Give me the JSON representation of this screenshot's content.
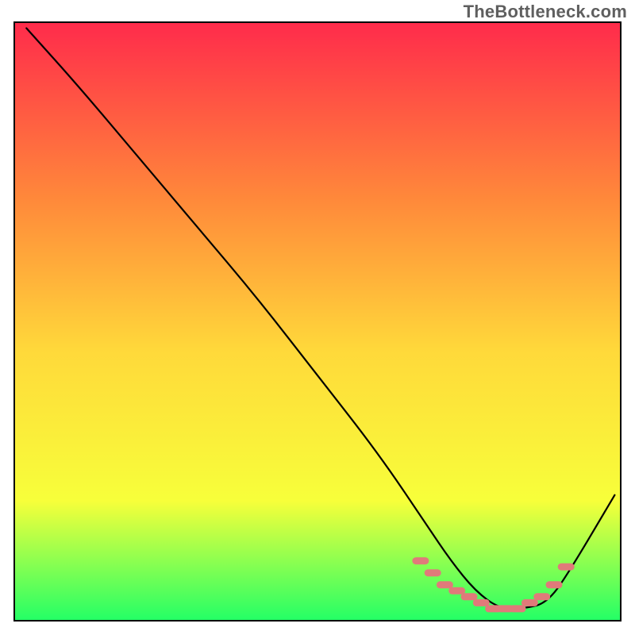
{
  "attribution": "TheBottleneck.com",
  "chart_data": {
    "type": "line",
    "title": "",
    "xlabel": "",
    "ylabel": "",
    "xlim": [
      0,
      100
    ],
    "ylim": [
      0,
      100
    ],
    "grid": false,
    "legend": false,
    "background_gradient": {
      "top_color": "#ff2b4b",
      "mid_upper_color": "#ff8a3a",
      "mid_color": "#ffd93a",
      "mid_lower_color": "#f7ff3a",
      "bottom_color": "#23ff66"
    },
    "series": [
      {
        "name": "bottleneck-curve",
        "color": "#000000",
        "x": [
          2,
          10,
          20,
          30,
          40,
          50,
          60,
          68,
          72,
          76,
          80,
          84,
          88,
          92,
          99
        ],
        "y": [
          99,
          90,
          78,
          66,
          54,
          41,
          28,
          16,
          10,
          5,
          2,
          2,
          3,
          9,
          21
        ]
      }
    ],
    "trough_highlight": {
      "name": "trough-dots",
      "color": "#e07a7a",
      "x": [
        67,
        69,
        71,
        73,
        75,
        77,
        79,
        81,
        83,
        85,
        87,
        89,
        91
      ],
      "y": [
        10,
        8,
        6,
        5,
        4,
        3,
        2,
        2,
        2,
        3,
        4,
        6,
        9
      ]
    }
  }
}
